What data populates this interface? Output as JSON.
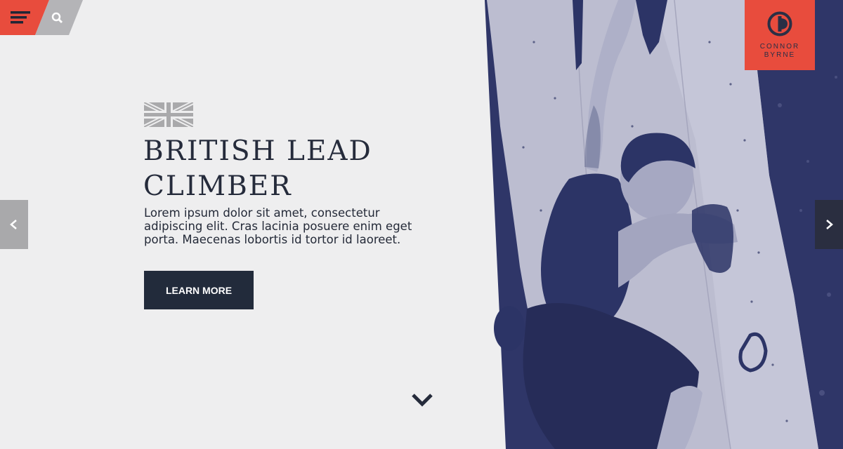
{
  "header": {
    "menu_icon": "hamburger-menu-icon",
    "search_icon": "search-icon"
  },
  "brand": {
    "logo_icon": "cb-monogram-icon",
    "name_line1": "CONNOR",
    "name_line2": "BYRNE"
  },
  "hero": {
    "flag_icon": "union-jack-flag-icon",
    "title_line1": "BRITISH LEAD",
    "title_line2": "CLIMBER",
    "description": "Lorem ipsum dolor sit amet, consectetur adipiscing elit. Cras lacinia posuere enim eget porta. Maecenas lobortis id tortor id laoreet.",
    "cta_label": "LEARN MORE"
  },
  "navigation": {
    "prev_icon": "chevron-left-icon",
    "next_icon": "chevron-right-icon",
    "scroll_icon": "chevron-down-icon"
  },
  "colors": {
    "accent": "#e84c3d",
    "dark": "#222b3b",
    "background": "#eeeeef",
    "image_tint": "#2c3466"
  }
}
